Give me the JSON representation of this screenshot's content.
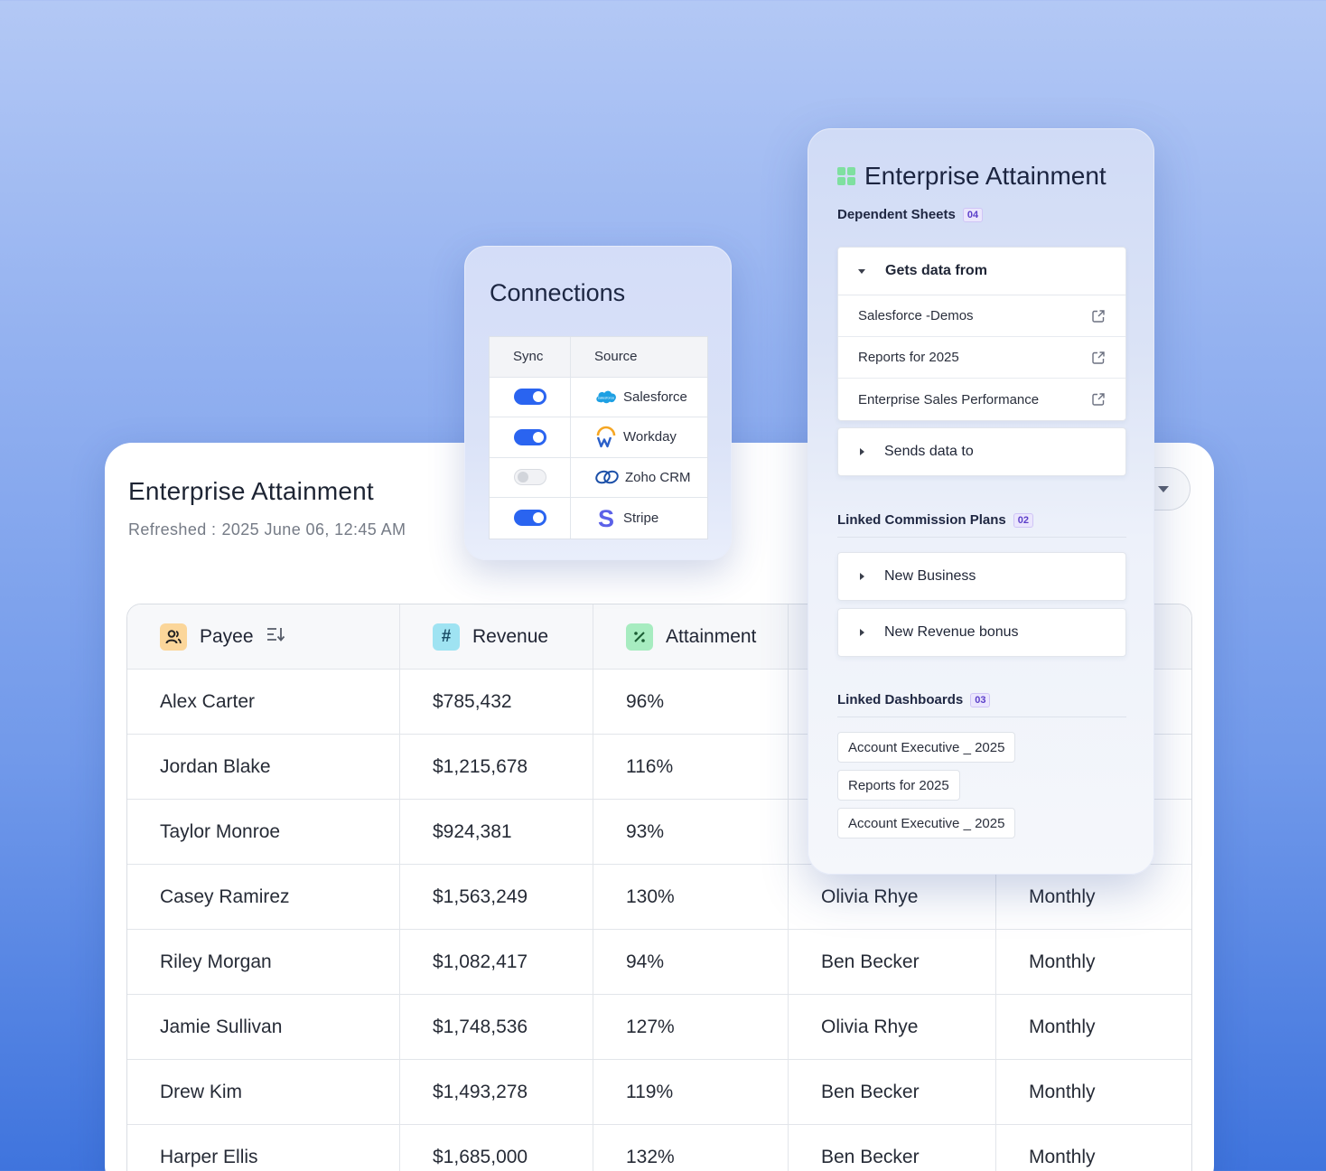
{
  "sheet": {
    "title": "Enterprise Attainment",
    "refreshed_label": "Refreshed :",
    "refreshed_value": "2025 June 06, 12:45 AM",
    "columns": [
      "Payee",
      "Revenue",
      "Attainment"
    ],
    "rows": [
      {
        "payee": "Alex Carter",
        "revenue": "$785,432",
        "attainment": "96%",
        "manager": "",
        "period": ""
      },
      {
        "payee": "Jordan Blake",
        "revenue": "$1,215,678",
        "attainment": "116%",
        "manager": "",
        "period": ""
      },
      {
        "payee": "Taylor Monroe",
        "revenue": "$924,381",
        "attainment": "93%",
        "manager": "",
        "period": ""
      },
      {
        "payee": "Casey Ramirez",
        "revenue": "$1,563,249",
        "attainment": "130%",
        "manager": "Olivia Rhye",
        "period": "Monthly"
      },
      {
        "payee": "Riley Morgan",
        "revenue": "$1,082,417",
        "attainment": "94%",
        "manager": "Ben Becker",
        "period": "Monthly"
      },
      {
        "payee": "Jamie Sullivan",
        "revenue": "$1,748,536",
        "attainment": "127%",
        "manager": "Olivia Rhye",
        "period": "Monthly"
      },
      {
        "payee": "Drew Kim",
        "revenue": "$1,493,278",
        "attainment": "119%",
        "manager": "Ben Becker",
        "period": "Monthly"
      },
      {
        "payee": "Harper Ellis",
        "revenue": "$1,685,000",
        "attainment": "132%",
        "manager": "Ben Becker",
        "period": "Monthly"
      }
    ]
  },
  "connections": {
    "title": "Connections",
    "headers": [
      "Sync",
      "Source"
    ],
    "sources": [
      {
        "name": "Salesforce",
        "sync": true
      },
      {
        "name": "Workday",
        "sync": true
      },
      {
        "name": "Zoho CRM",
        "sync": false
      },
      {
        "name": "Stripe",
        "sync": true
      }
    ],
    "salesforce_logo_text": "salesforce"
  },
  "dependencies": {
    "title": "Enterprise Attainment",
    "dependent_sheets": {
      "label": "Dependent Sheets",
      "count": "04",
      "gets_data_from": {
        "label": "Gets data from",
        "items": [
          "Salesforce -Demos",
          "Reports for 2025",
          "Enterprise Sales Performance"
        ]
      },
      "sends_data_to": {
        "label": "Sends data to"
      }
    },
    "linked_plans": {
      "label": "Linked Commission Plans",
      "count": "02",
      "items": [
        "New Business",
        "New Revenue bonus"
      ]
    },
    "linked_dashboards": {
      "label": "Linked Dashboards",
      "count": "03",
      "items": [
        "Account Executive _ 2025",
        "Reports for 2025",
        "Account Executive _ 2025"
      ]
    }
  },
  "colors": {
    "accent_blue": "#2a64f0",
    "badge_purple": "#5b3fc9",
    "payee_icon_bg": "#fbd69a",
    "revenue_icon_bg": "#9fe3f2",
    "attainment_icon_bg": "#a7ecc0"
  },
  "icons": {
    "payee": "person-icon",
    "revenue": "hash-icon",
    "attainment": "percent-icon",
    "sort": "sort-icon",
    "sheet": "grid-icon",
    "external": "external-link-icon"
  }
}
